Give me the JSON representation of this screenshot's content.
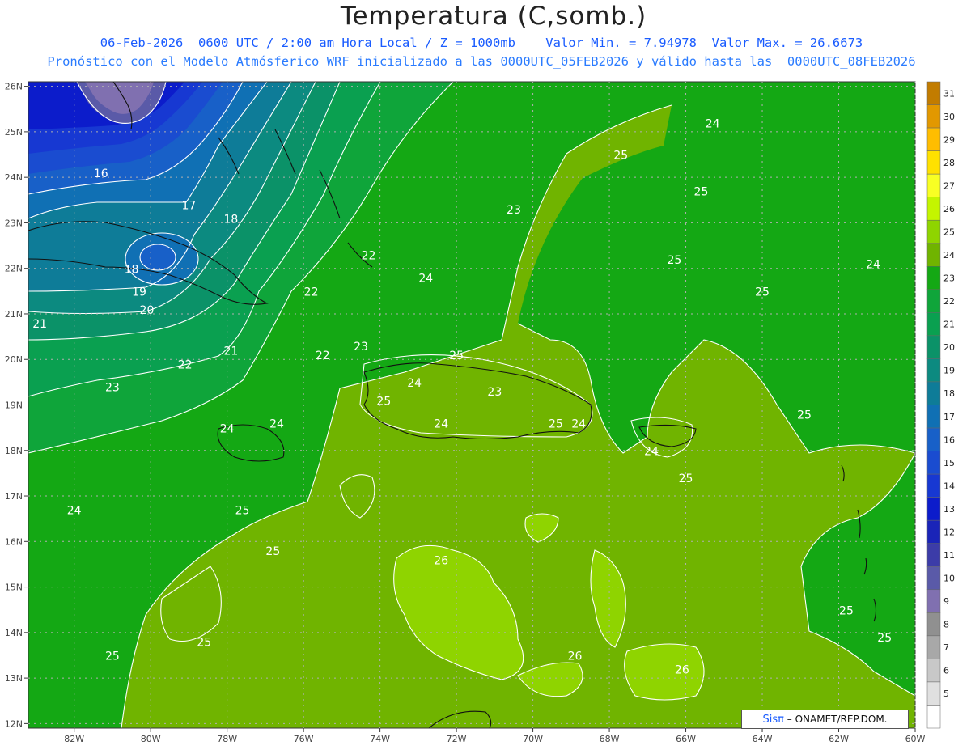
{
  "header": {
    "title": "Temperatura (C,somb.)",
    "subtitle_line1": "06-Feb-2026  0600 UTC / 2:00 am Hora Local / Z = 1000mb    Valor Min. = 7.94978  Valor Max. = 26.6673",
    "subtitle_line2": "Pronóstico con el Modelo Atmósferico WRF inicializado a las 0000UTC_05FEB2026 y válido hasta las  0000UTC_08FEB2026"
  },
  "map": {
    "extent": {
      "lon_min": -83.2,
      "lon_max": -60.0,
      "lat_min": 11.9,
      "lat_max": 26.1
    },
    "lon_ticks": [
      {
        "lon": -82,
        "label": "82W"
      },
      {
        "lon": -80,
        "label": "80W"
      },
      {
        "lon": -78,
        "label": "78W"
      },
      {
        "lon": -76,
        "label": "76W"
      },
      {
        "lon": -74,
        "label": "74W"
      },
      {
        "lon": -72,
        "label": "72W"
      },
      {
        "lon": -70,
        "label": "70W"
      },
      {
        "lon": -68,
        "label": "68W"
      },
      {
        "lon": -66,
        "label": "66W"
      },
      {
        "lon": -64,
        "label": "64W"
      },
      {
        "lon": -62,
        "label": "62W"
      },
      {
        "lon": -60,
        "label": "60W"
      }
    ],
    "lat_ticks": [
      {
        "lat": 26,
        "label": "26N"
      },
      {
        "lat": 25,
        "label": "25N"
      },
      {
        "lat": 24,
        "label": "24N"
      },
      {
        "lat": 23,
        "label": "23N"
      },
      {
        "lat": 22,
        "label": "22N"
      },
      {
        "lat": 21,
        "label": "21N"
      },
      {
        "lat": 20,
        "label": "20N"
      },
      {
        "lat": 19,
        "label": "19N"
      },
      {
        "lat": 18,
        "label": "18N"
      },
      {
        "lat": 17,
        "label": "17N"
      },
      {
        "lat": 16,
        "label": "16N"
      },
      {
        "lat": 15,
        "label": "15N"
      },
      {
        "lat": 14,
        "label": "14N"
      },
      {
        "lat": 13,
        "label": "13N"
      },
      {
        "lat": 12,
        "label": "12N"
      }
    ],
    "contour_labels": [
      {
        "lon": -81.3,
        "lat": 24.0,
        "text": "16"
      },
      {
        "lon": -79.0,
        "lat": 23.3,
        "text": "17"
      },
      {
        "lon": -77.9,
        "lat": 23.0,
        "text": "18"
      },
      {
        "lon": -80.5,
        "lat": 21.9,
        "text": "18"
      },
      {
        "lon": -80.3,
        "lat": 21.4,
        "text": "19"
      },
      {
        "lon": -80.1,
        "lat": 21.0,
        "text": "20"
      },
      {
        "lon": -82.9,
        "lat": 20.7,
        "text": "21"
      },
      {
        "lon": -77.9,
        "lat": 20.1,
        "text": "21"
      },
      {
        "lon": -79.1,
        "lat": 19.8,
        "text": "22"
      },
      {
        "lon": -81.0,
        "lat": 19.3,
        "text": "23"
      },
      {
        "lon": -74.3,
        "lat": 22.2,
        "text": "22"
      },
      {
        "lon": -75.8,
        "lat": 21.4,
        "text": "22"
      },
      {
        "lon": -75.5,
        "lat": 20.0,
        "text": "22"
      },
      {
        "lon": -74.5,
        "lat": 20.2,
        "text": "23"
      },
      {
        "lon": -70.5,
        "lat": 23.2,
        "text": "23"
      },
      {
        "lon": -71.0,
        "lat": 19.2,
        "text": "23"
      },
      {
        "lon": -72.8,
        "lat": 21.7,
        "text": "24"
      },
      {
        "lon": -73.1,
        "lat": 19.4,
        "text": "24"
      },
      {
        "lon": -72.4,
        "lat": 18.5,
        "text": "24"
      },
      {
        "lon": -78.0,
        "lat": 18.4,
        "text": "24"
      },
      {
        "lon": -76.7,
        "lat": 18.5,
        "text": "24"
      },
      {
        "lon": -82.0,
        "lat": 16.6,
        "text": "24"
      },
      {
        "lon": -68.8,
        "lat": 18.5,
        "text": "24"
      },
      {
        "lon": -66.9,
        "lat": 17.9,
        "text": "24"
      },
      {
        "lon": -65.3,
        "lat": 25.1,
        "text": "24"
      },
      {
        "lon": -61.1,
        "lat": 22.0,
        "text": "24"
      },
      {
        "lon": -67.7,
        "lat": 24.4,
        "text": "25"
      },
      {
        "lon": -65.6,
        "lat": 23.6,
        "text": "25"
      },
      {
        "lon": -66.3,
        "lat": 22.1,
        "text": "25"
      },
      {
        "lon": -64.0,
        "lat": 21.4,
        "text": "25"
      },
      {
        "lon": -72.0,
        "lat": 20.0,
        "text": "25"
      },
      {
        "lon": -73.9,
        "lat": 19.0,
        "text": "25"
      },
      {
        "lon": -69.4,
        "lat": 18.5,
        "text": "25"
      },
      {
        "lon": -62.9,
        "lat": 18.7,
        "text": "25"
      },
      {
        "lon": -66.0,
        "lat": 17.3,
        "text": "25"
      },
      {
        "lon": -77.6,
        "lat": 16.6,
        "text": "25"
      },
      {
        "lon": -76.8,
        "lat": 15.7,
        "text": "25"
      },
      {
        "lon": -78.6,
        "lat": 13.7,
        "text": "25"
      },
      {
        "lon": -81.0,
        "lat": 13.4,
        "text": "25"
      },
      {
        "lon": -61.8,
        "lat": 14.4,
        "text": "25"
      },
      {
        "lon": -60.8,
        "lat": 13.8,
        "text": "25"
      },
      {
        "lon": -72.4,
        "lat": 15.5,
        "text": "26"
      },
      {
        "lon": -68.9,
        "lat": 13.4,
        "text": "26"
      },
      {
        "lon": -66.1,
        "lat": 13.1,
        "text": "26"
      }
    ]
  },
  "legend": {
    "levels": [
      {
        "label": "31",
        "color": "#c27c00"
      },
      {
        "label": "30",
        "color": "#e29800"
      },
      {
        "label": "29",
        "color": "#ffbd00"
      },
      {
        "label": "28",
        "color": "#ffe100"
      },
      {
        "label": "27",
        "color": "#f8ff24"
      },
      {
        "label": "26",
        "color": "#c4f500"
      },
      {
        "label": "25",
        "color": "#8fd400"
      },
      {
        "label": "24",
        "color": "#70b400"
      },
      {
        "label": "23",
        "color": "#14a814"
      },
      {
        "label": "22",
        "color": "#0fa53a"
      },
      {
        "label": "21",
        "color": "#0aa050"
      },
      {
        "label": "20",
        "color": "#0b9268"
      },
      {
        "label": "19",
        "color": "#0c8a80"
      },
      {
        "label": "18",
        "color": "#0e7c98"
      },
      {
        "label": "17",
        "color": "#1070b4"
      },
      {
        "label": "16",
        "color": "#1860c8"
      },
      {
        "label": "15",
        "color": "#1a4cd0"
      },
      {
        "label": "14",
        "color": "#1738d2"
      },
      {
        "label": "13",
        "color": "#0c1ccb"
      },
      {
        "label": "12",
        "color": "#1a24b8"
      },
      {
        "label": "11",
        "color": "#3c3ca8"
      },
      {
        "label": "10",
        "color": "#5a5aa8"
      },
      {
        "label": "9",
        "color": "#8070b0"
      },
      {
        "label": "8",
        "color": "#909090"
      },
      {
        "label": "7",
        "color": "#a8a8a8"
      },
      {
        "label": "6",
        "color": "#c8c8c8"
      },
      {
        "label": "5",
        "color": "#e0e0e0"
      },
      {
        "label": "",
        "color": "#ffffff"
      }
    ]
  },
  "credit": {
    "brand": "Sisπ",
    "text": "– ONAMET/REP.DOM."
  }
}
